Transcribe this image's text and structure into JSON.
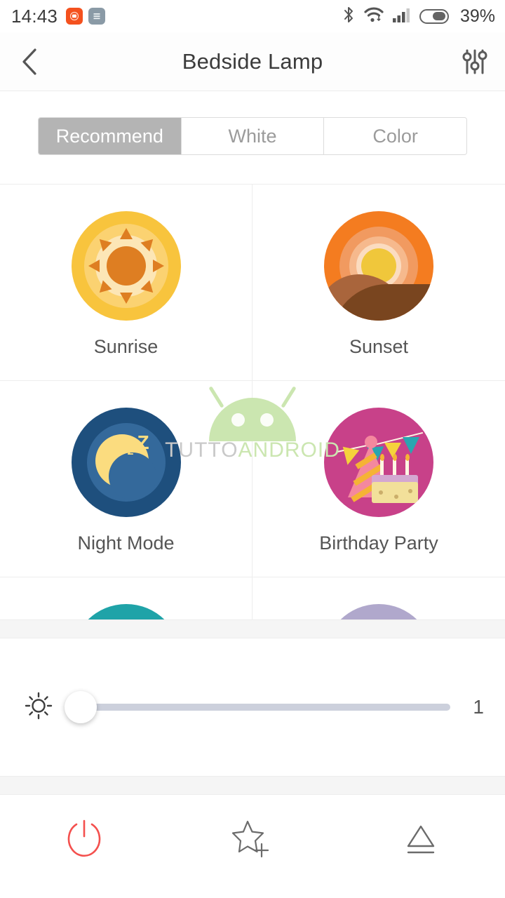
{
  "statusbar": {
    "time": "14:43",
    "battery_percent": "39%",
    "icons": [
      "camera-app-icon",
      "notes-app-icon",
      "bluetooth-icon",
      "wifi-icon",
      "cellular-signal-icon",
      "battery-icon"
    ]
  },
  "appbar": {
    "title": "Bedside Lamp",
    "back_icon": "chevron-left-icon",
    "settings_icon": "sliders-icon"
  },
  "tabs": [
    {
      "label": "Recommend",
      "active": true
    },
    {
      "label": "White",
      "active": false
    },
    {
      "label": "Color",
      "active": false
    }
  ],
  "scenes": [
    {
      "label": "Sunrise",
      "icon": "sunrise-icon",
      "color": "#f8c43d"
    },
    {
      "label": "Sunset",
      "icon": "sunset-icon",
      "color": "#f47c20"
    },
    {
      "label": "Night Mode",
      "icon": "night-mode-icon",
      "color": "#1e4f7d"
    },
    {
      "label": "Birthday Party",
      "icon": "birthday-party-icon",
      "color": "#c84189"
    },
    {
      "label": "",
      "icon": "teal-scene-icon",
      "color": "#1fa3a8"
    },
    {
      "label": "",
      "icon": "lilac-scene-icon",
      "color": "#b0a8cc"
    }
  ],
  "watermark": {
    "text_part1": "TUTTO",
    "text_part2": "ANDROID",
    "logo": "android-head-logo"
  },
  "brightness": {
    "icon": "brightness-sun-icon",
    "value": "1",
    "position_percent": 0
  },
  "bottom_actions": [
    {
      "name": "power-button",
      "icon": "power-icon",
      "color": "#f4504e"
    },
    {
      "name": "favorite-button",
      "icon": "star-plus-icon",
      "color": "#6b6b6b"
    },
    {
      "name": "eject-button",
      "icon": "eject-icon",
      "color": "#6b6b6b"
    }
  ]
}
